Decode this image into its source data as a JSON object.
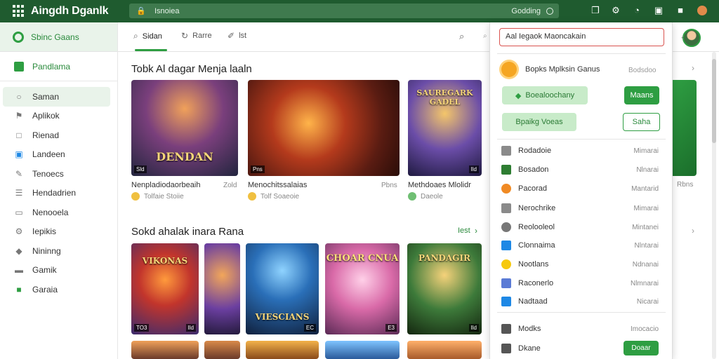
{
  "topbar": {
    "brand": "Aingdh Dganlk",
    "url": "Isnoiea",
    "url_right": "Godding",
    "icons": [
      "bookmark-icon",
      "puzzle-icon",
      "clock-icon",
      "shield-icon",
      "notification-icon",
      "profile-icon"
    ]
  },
  "sidebar": {
    "top_label": "Sbinc Gaans",
    "section_label": "Pandlama",
    "items": [
      {
        "label": "Saman",
        "icon": "home-icon"
      },
      {
        "label": "Aplikok",
        "icon": "apps-icon"
      },
      {
        "label": "Rienad",
        "icon": "monitor-icon"
      },
      {
        "label": "Landeen",
        "icon": "category-icon"
      },
      {
        "label": "Tenoecs",
        "icon": "edit-icon"
      },
      {
        "label": "Hendadrien",
        "icon": "list-icon"
      },
      {
        "label": "Nenooela",
        "icon": "book-icon"
      },
      {
        "label": "Iepikis",
        "icon": "settings-icon"
      },
      {
        "label": "Nininng",
        "icon": "flag-icon"
      },
      {
        "label": "Gamik",
        "icon": "game-icon"
      },
      {
        "label": "Garaia",
        "icon": "wallet-icon"
      }
    ]
  },
  "tabs": [
    {
      "label": "Sidan",
      "icon": "search-icon"
    },
    {
      "label": "Rarre",
      "icon": "refresh-icon"
    },
    {
      "label": "lst",
      "icon": "tag-icon"
    }
  ],
  "section1": {
    "title": "Tobk Al dagar Menja laaln",
    "cards": [
      {
        "title_art": "DENDAN",
        "badge": "Sld",
        "badge_r": "",
        "label": "Nenpladiodaorbeaih",
        "right": "Zold",
        "sub": "Tolfaie Stoiie"
      },
      {
        "title_art": "",
        "badge": "Pns",
        "badge_r": "",
        "label": "Menochitssalaias",
        "right": "Pbns",
        "sub": "Tolf Soaeoie"
      },
      {
        "title_art": "SAUREGARK GADEL",
        "badge": "",
        "badge_r": "Ild",
        "label": "Methdoaes Mlolidr",
        "right": "",
        "sub": "Daeole"
      }
    ]
  },
  "section2": {
    "title": "Sokd ahalak inara Rana",
    "see_all": "Iest",
    "cards": [
      {
        "title_art": "VIKONAS",
        "badge": "TO3",
        "badge_r": "Ild"
      },
      {
        "title_art": "",
        "badge": "",
        "badge_r": ""
      },
      {
        "title_art": "VIESCIANS",
        "badge": "",
        "badge_r": "EC"
      },
      {
        "title_art": "CHOAR CNUA",
        "badge": "",
        "badge_r": "E3"
      },
      {
        "title_art": "PANDAGIR",
        "badge": "",
        "badge_r": "Ild"
      }
    ]
  },
  "panel": {
    "search_value": "Aal Iegaok Maoncakain",
    "header_title": "Bopks Mplksin Ganus",
    "header_right": "Bodsdoo",
    "buttons": {
      "primary_light": "Boealoochany",
      "primary_dark": "Maans",
      "secondary_light": "Bpaikg Voeas",
      "secondary_outline": "Saha"
    },
    "rows": [
      {
        "label": "Rodadoie",
        "value": "Mimarai",
        "color": "#8a8a8a"
      },
      {
        "label": "Bosadon",
        "value": "Nlnarai",
        "color": "#2e7d32"
      },
      {
        "label": "Pacorad",
        "value": "Mantarid",
        "color": "#f08a24"
      },
      {
        "label": "Nerochrike",
        "value": "Mimarai",
        "color": "#8a8a8a"
      },
      {
        "label": "Reolooleol",
        "value": "Mintanei",
        "color": "#777777"
      },
      {
        "label": "Clonnaima",
        "value": "Nlntarai",
        "color": "#1e88e5"
      },
      {
        "label": "Nootlans",
        "value": "Ndnanai",
        "color": "#f6c90e"
      },
      {
        "label": "Raconerlo",
        "value": "Nlmnarai",
        "color": "#5b7bd5"
      },
      {
        "label": "Nadtaad",
        "value": "Nicarai",
        "color": "#1e88e5"
      }
    ],
    "bottom_rows": [
      {
        "label": "Modks",
        "value": "Imocacio",
        "color": "#555555"
      },
      {
        "label": "Dkane",
        "value": "",
        "color": "#555555"
      }
    ],
    "bottom_button": "Doaar"
  },
  "right": {
    "label": "Rbns"
  }
}
